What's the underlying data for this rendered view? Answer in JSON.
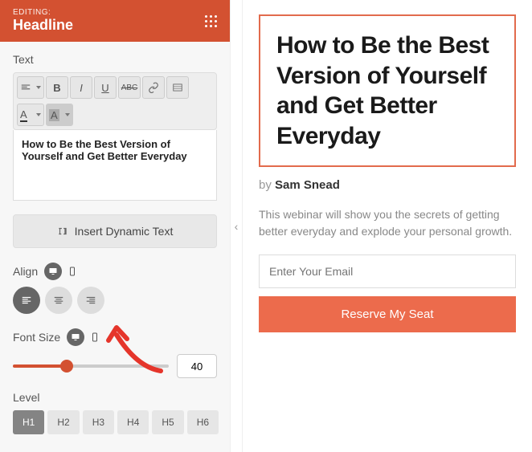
{
  "header": {
    "editing": "EDITING:",
    "element": "Headline"
  },
  "text": {
    "label": "Text",
    "value": "How to Be the Best Version of Yourself and Get Better Everyday"
  },
  "dynamic": {
    "label": "Insert Dynamic Text"
  },
  "align": {
    "label": "Align"
  },
  "fontSize": {
    "label": "Font Size",
    "value": "40"
  },
  "level": {
    "label": "Level",
    "options": [
      "H1",
      "H2",
      "H3",
      "H4",
      "H5",
      "H6"
    ],
    "active": "H1"
  },
  "preview": {
    "title": "How to Be the Best Version of Yourself and Get Better Everyday",
    "by": "by ",
    "author": "Sam Snead",
    "desc": "This webinar will show you the secrets of getting better everyday and explode your personal growth.",
    "emailPlaceholder": "Enter Your Email",
    "cta": "Reserve My Seat"
  }
}
